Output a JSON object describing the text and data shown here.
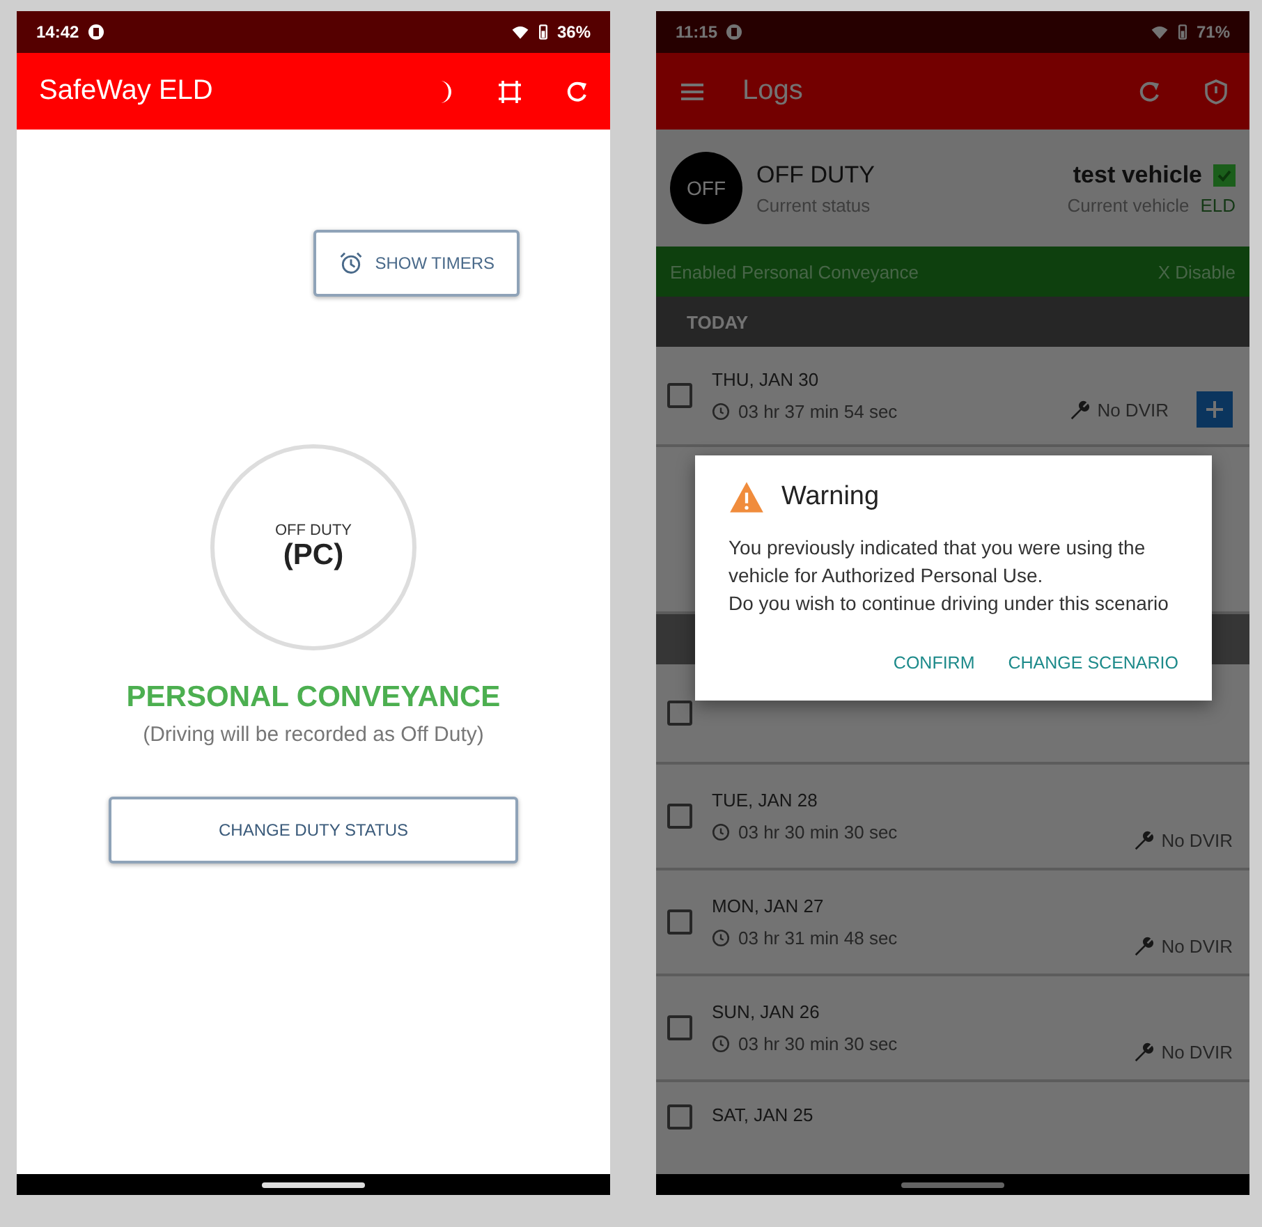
{
  "left_screen": {
    "status_bar": {
      "time": "14:42",
      "battery": "36%"
    },
    "app_bar": {
      "title": "SafeWay ELD"
    },
    "show_timers_button": {
      "label": "SHOW TIMERS"
    },
    "status_circle": {
      "label": "OFF DUTY",
      "code": "(PC)"
    },
    "mode_title": "PERSONAL CONVEYANCE",
    "mode_note": "(Driving will be recorded as Off Duty)",
    "change_status_button": {
      "label": "CHANGE DUTY STATUS"
    }
  },
  "right_screen": {
    "status_bar": {
      "time": "11:15",
      "battery": "71%"
    },
    "app_bar": {
      "title": "Logs"
    },
    "driver_status": {
      "badge": "OFF",
      "status": "OFF DUTY",
      "status_caption": "Current status",
      "vehicle": "test vehicle",
      "vehicle_caption": "Current vehicle",
      "device": "ELD"
    },
    "banner": {
      "text": "Enabled Personal Conveyance",
      "action": "X Disable"
    },
    "section": "TODAY",
    "logs": [
      {
        "date": "THU, JAN 30",
        "duration": "03 hr 37 min 54 sec",
        "dvir": "No DVIR",
        "checked": false,
        "kind": "today"
      },
      {
        "checked": false,
        "kind": "hidden"
      },
      {
        "date": "TUE, JAN 28",
        "duration": "03 hr 30 min 30 sec",
        "dvir": "No DVIR",
        "checked": false,
        "kind": "day"
      },
      {
        "date": "MON, JAN 27",
        "duration": "03 hr 31 min 48 sec",
        "dvir": "No DVIR",
        "checked": false,
        "kind": "day"
      },
      {
        "date": "SUN, JAN 26",
        "duration": "03 hr 30 min 30 sec",
        "dvir": "No DVIR",
        "checked": false,
        "kind": "day"
      },
      {
        "date": "SAT, JAN 25",
        "checked": false,
        "kind": "partial"
      }
    ],
    "dialog": {
      "title": "Warning",
      "message": "You previously indicated that you were using the vehicle for Authorized Personal Use.\nDo you wish to continue driving under this scenario",
      "buttons": [
        "CONFIRM",
        "CHANGE SCENARIO"
      ]
    }
  }
}
